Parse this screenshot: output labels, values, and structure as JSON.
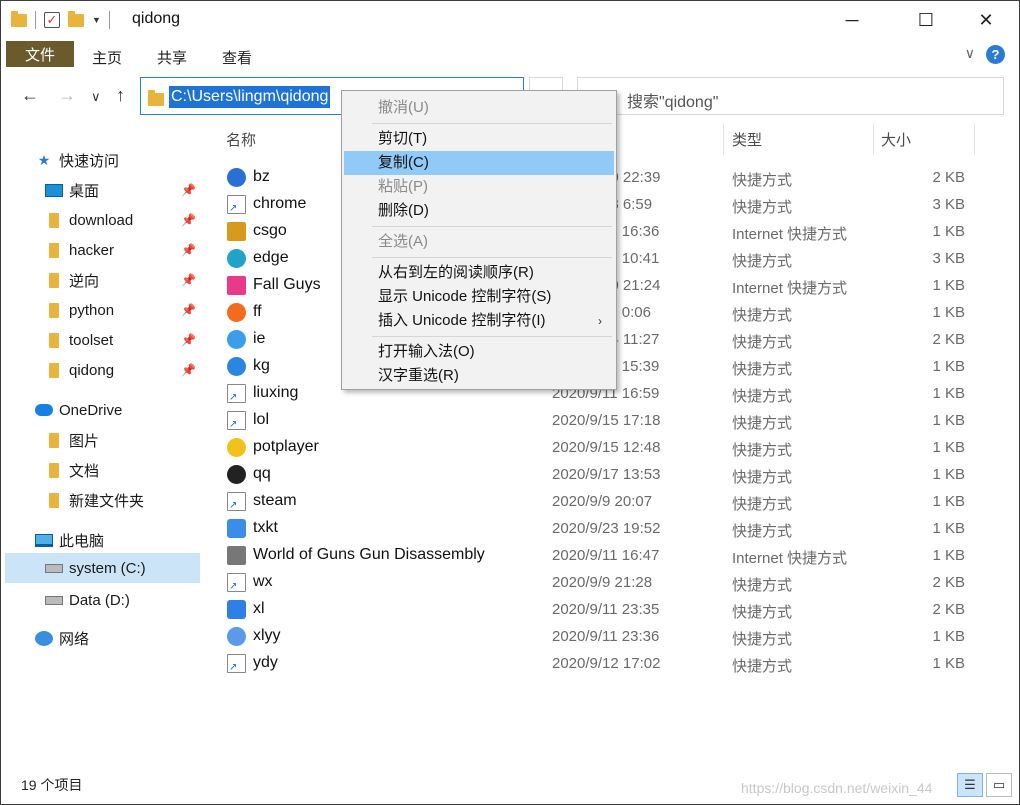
{
  "window": {
    "title": "qidong",
    "controls": {
      "minimize": "─",
      "maximize": "☐",
      "close": "✕"
    }
  },
  "ribbon": {
    "file_tab": "文件",
    "tabs": [
      "主页",
      "共享",
      "查看"
    ],
    "help": "?",
    "expand": "∨"
  },
  "nav": {
    "back": "←",
    "forward": "→",
    "recent": "∨",
    "up": "↑",
    "address": "C:\\Users\\lingm\\qidong",
    "refresh": "↻",
    "search_placeholder": "搜索\"qidong\""
  },
  "sidebar": {
    "quick_access": "快速访问",
    "quick_items": [
      "桌面",
      "download",
      "hacker",
      "逆向",
      "python",
      "toolset",
      "qidong"
    ],
    "onedrive": "OneDrive",
    "onedrive_items": [
      "图片",
      "文档",
      "新建文件夹"
    ],
    "this_pc": "此电脑",
    "drives": [
      "system (C:)",
      "Data (D:)"
    ],
    "network": "网络"
  },
  "columns": {
    "name": "名称",
    "type": "类型",
    "size": "大小"
  },
  "files": [
    {
      "name": "bz",
      "date": "2020/9/10 22:39",
      "type": "快捷方式",
      "size": "2 KB",
      "icon": "blue-round-icon"
    },
    {
      "name": "chrome",
      "date": "2020/9/23 6:59",
      "type": "快捷方式",
      "size": "3 KB",
      "icon": "shortcut-icon"
    },
    {
      "name": "csgo",
      "date": "2020/9/11 16:36",
      "type": "Internet 快捷方式",
      "size": "1 KB",
      "icon": "csgo-icon"
    },
    {
      "name": "edge",
      "date": "2020/9/11 10:41",
      "type": "快捷方式",
      "size": "3 KB",
      "icon": "edge-icon"
    },
    {
      "name": "Fall Guys",
      "date": "2020/9/10 21:24",
      "type": "Internet 快捷方式",
      "size": "1 KB",
      "icon": "fallguys-icon"
    },
    {
      "name": "ff",
      "date": "2020/9/11 0:06",
      "type": "快捷方式",
      "size": "1 KB",
      "icon": "firefox-icon"
    },
    {
      "name": "ie",
      "date": "2020/9/14 11:27",
      "type": "快捷方式",
      "size": "2 KB",
      "icon": "ie-icon"
    },
    {
      "name": "kg",
      "date": "2020/9/11 15:39",
      "type": "快捷方式",
      "size": "1 KB",
      "icon": "kg-icon"
    },
    {
      "name": "liuxing",
      "date": "2020/9/11 16:59",
      "type": "快捷方式",
      "size": "1 KB",
      "icon": "shortcut-icon"
    },
    {
      "name": "lol",
      "date": "2020/9/15 17:18",
      "type": "快捷方式",
      "size": "1 KB",
      "icon": "shortcut-icon"
    },
    {
      "name": "potplayer",
      "date": "2020/9/15 12:48",
      "type": "快捷方式",
      "size": "1 KB",
      "icon": "potplayer-icon"
    },
    {
      "name": "qq",
      "date": "2020/9/17 13:53",
      "type": "快捷方式",
      "size": "1 KB",
      "icon": "qq-icon"
    },
    {
      "name": "steam",
      "date": "2020/9/9 20:07",
      "type": "快捷方式",
      "size": "1 KB",
      "icon": "shortcut-icon"
    },
    {
      "name": "txkt",
      "date": "2020/9/23 19:52",
      "type": "快捷方式",
      "size": "1 KB",
      "icon": "txkt-icon"
    },
    {
      "name": "World of Guns Gun Disassembly",
      "date": "2020/9/11 16:47",
      "type": "Internet 快捷方式",
      "size": "1 KB",
      "icon": "gun-icon"
    },
    {
      "name": "wx",
      "date": "2020/9/9 21:28",
      "type": "快捷方式",
      "size": "2 KB",
      "icon": "shortcut-icon"
    },
    {
      "name": "xl",
      "date": "2020/9/11 23:35",
      "type": "快捷方式",
      "size": "2 KB",
      "icon": "xl-icon"
    },
    {
      "name": "xlyy",
      "date": "2020/9/11 23:36",
      "type": "快捷方式",
      "size": "1 KB",
      "icon": "xlyy-icon"
    },
    {
      "name": "ydy",
      "date": "2020/9/12 17:02",
      "type": "快捷方式",
      "size": "1 KB",
      "icon": "shortcut-icon"
    }
  ],
  "status": {
    "count": "19 个项目",
    "watermark": "https://blog.csdn.net/weixin_44"
  },
  "context_menu": {
    "undo": "撤消(U)",
    "cut": "剪切(T)",
    "copy": "复制(C)",
    "paste": "粘贴(P)",
    "delete": "删除(D)",
    "select_all": "全选(A)",
    "rtl": "从右到左的阅读顺序(R)",
    "show_unicode": "显示 Unicode 控制字符(S)",
    "insert_unicode": "插入 Unicode 控制字符(I)",
    "open_ime": "打开输入法(O)",
    "reconvert": "汉字重选(R)",
    "submenu_arrow": "›"
  },
  "colors": {
    "accent": "#1e73d4",
    "file_tab": "#6b5b2c",
    "menu_highlight": "#91c9f7",
    "selected_nav": "#cce4f7"
  }
}
